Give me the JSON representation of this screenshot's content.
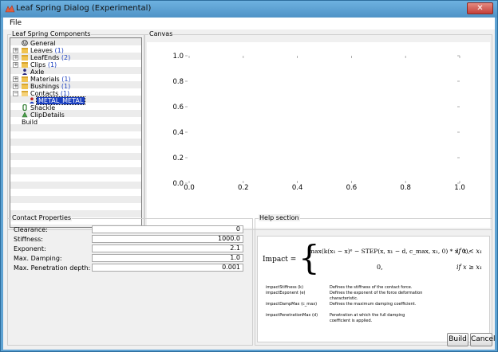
{
  "window": {
    "title": "Leaf Spring Dialog (Experimental)",
    "close_label": "✕"
  },
  "menu": {
    "file": "File"
  },
  "components": {
    "group_label": "Leaf Spring Components",
    "items": [
      {
        "label": "General",
        "count": "",
        "icon": "general-icon",
        "expander": ""
      },
      {
        "label": "Leaves",
        "count": "(1)",
        "icon": "folder-icon",
        "expander": "+"
      },
      {
        "label": "LeafEnds",
        "count": "(2)",
        "icon": "folder-icon",
        "expander": "+"
      },
      {
        "label": "Clips",
        "count": "(1)",
        "icon": "folder-icon",
        "expander": "+"
      },
      {
        "label": "Axle",
        "count": "",
        "icon": "axle-icon",
        "expander": ""
      },
      {
        "label": "Materials",
        "count": "(1)",
        "icon": "folder-icon",
        "expander": "+"
      },
      {
        "label": "Bushings",
        "count": "(1)",
        "icon": "folder-icon",
        "expander": "+"
      },
      {
        "label": "Contacts",
        "count": "(1)",
        "icon": "folder-open-icon",
        "expander": "−"
      },
      {
        "label": "METAL_METAL",
        "count": "",
        "icon": "contact-icon",
        "expander": ""
      },
      {
        "label": "Shackle",
        "count": "",
        "icon": "shackle-icon",
        "expander": ""
      },
      {
        "label": "ClipDetails",
        "count": "",
        "icon": "clip-details-icon",
        "expander": ""
      },
      {
        "label": "Build",
        "count": "",
        "icon": "",
        "expander": ""
      }
    ]
  },
  "canvas": {
    "group_label": "Canvas",
    "chart_data": {
      "type": "line",
      "series": [],
      "xlim": [
        0.0,
        1.0
      ],
      "ylim": [
        0.0,
        1.0
      ],
      "x_ticks": [
        "0.0",
        "0.2",
        "0.4",
        "0.6",
        "0.8",
        "1.0"
      ],
      "y_ticks": [
        "0.0",
        "0.2",
        "0.4",
        "0.6",
        "0.8",
        "1.0"
      ],
      "title": "",
      "xlabel": "",
      "ylabel": ""
    }
  },
  "contact_properties": {
    "group_label": "Contact Properties",
    "rows": [
      {
        "label": "Clearance:",
        "value": "0"
      },
      {
        "label": "Stiffness:",
        "value": "1000.0"
      },
      {
        "label": "Exponent:",
        "value": "2.1"
      },
      {
        "label": "Max. Damping:",
        "value": "1.0"
      },
      {
        "label": "Max. Penetration depth:",
        "value": "0.001"
      }
    ]
  },
  "help": {
    "group_label": "Help section",
    "formula": {
      "lhs": "Impact =",
      "case1": "max(k(x₁ − x)ᵉ − STEP(x, x₁ − d, c_max, x₁, 0) * ẋ, 0),",
      "cond1": "if  x < x₁",
      "case2": "0,",
      "cond2": "if  x ≥ x₁"
    },
    "params": [
      {
        "name": "impactStiffness (k)",
        "desc": "Defines the stiffness of the contact force."
      },
      {
        "name": "impactExponent (e)",
        "desc": "Defines the exponent of the force deformation characteristic."
      },
      {
        "name": "impactDampMax (c_max)",
        "desc": "Defines the maximum damping coefficient."
      },
      {
        "name": "impactPenetrationMax (d)",
        "desc": "Penetration at which the full damping coefficient is applied."
      }
    ]
  },
  "buttons": {
    "build": "Build",
    "cancel": "Cancel"
  }
}
